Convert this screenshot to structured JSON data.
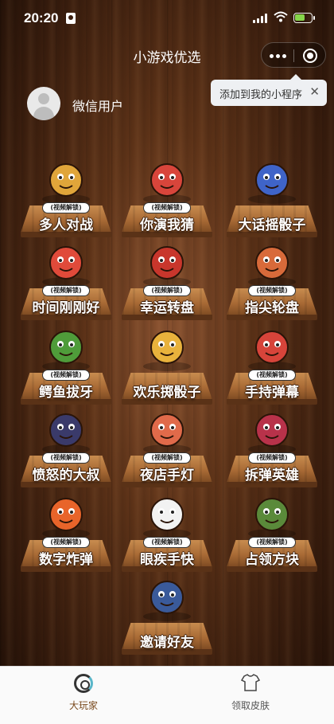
{
  "status": {
    "time": "20:20"
  },
  "nav": {
    "title": "小游戏优选"
  },
  "tooltip": {
    "text": "添加到我的小程序",
    "close": "✕"
  },
  "user": {
    "name": "微信用户"
  },
  "unlock_tag": "(视频解锁)",
  "games": [
    {
      "name": "多人对战",
      "icon": "fist-bump-icon",
      "locked": true
    },
    {
      "name": "你演我猜",
      "icon": "film-character-icon",
      "locked": true
    },
    {
      "name": "大话摇骰子",
      "icon": "dice-cup-icon",
      "locked": false
    },
    {
      "name": "时间刚刚好",
      "icon": "alarm-clock-icon",
      "locked": true
    },
    {
      "name": "幸运转盘",
      "icon": "lucky-wheel-icon",
      "locked": true
    },
    {
      "name": "指尖轮盘",
      "icon": "finger-spinner-icon",
      "locked": true
    },
    {
      "name": "鳄鱼拔牙",
      "icon": "crocodile-icon",
      "locked": true
    },
    {
      "name": "欢乐掷骰子",
      "icon": "gold-dice-icon",
      "locked": false
    },
    {
      "name": "手持弹幕",
      "icon": "phone-banner-icon",
      "locked": true
    },
    {
      "name": "愤怒的大叔",
      "icon": "angry-man-icon",
      "locked": true
    },
    {
      "name": "夜店手灯",
      "icon": "phone-light-icon",
      "locked": true
    },
    {
      "name": "拆弹英雄",
      "icon": "bomb-icon",
      "locked": true
    },
    {
      "name": "数字炸弹",
      "icon": "number-bomb-icon",
      "locked": true
    },
    {
      "name": "眼疾手快",
      "icon": "eyes-icon",
      "locked": true
    },
    {
      "name": "占领方块",
      "icon": "soldiers-icon",
      "locked": true
    },
    {
      "name": "邀请好友",
      "icon": "friends-icon",
      "locked": false
    }
  ],
  "tabbar": {
    "tabs": [
      {
        "label": "大玩家",
        "icon": "ring-icon"
      },
      {
        "label": "领取皮肤",
        "icon": "shirt-icon"
      }
    ]
  },
  "colors": {
    "active_tab": "#7a4a1e",
    "board": "#a86a35",
    "background": "#5e3318"
  }
}
